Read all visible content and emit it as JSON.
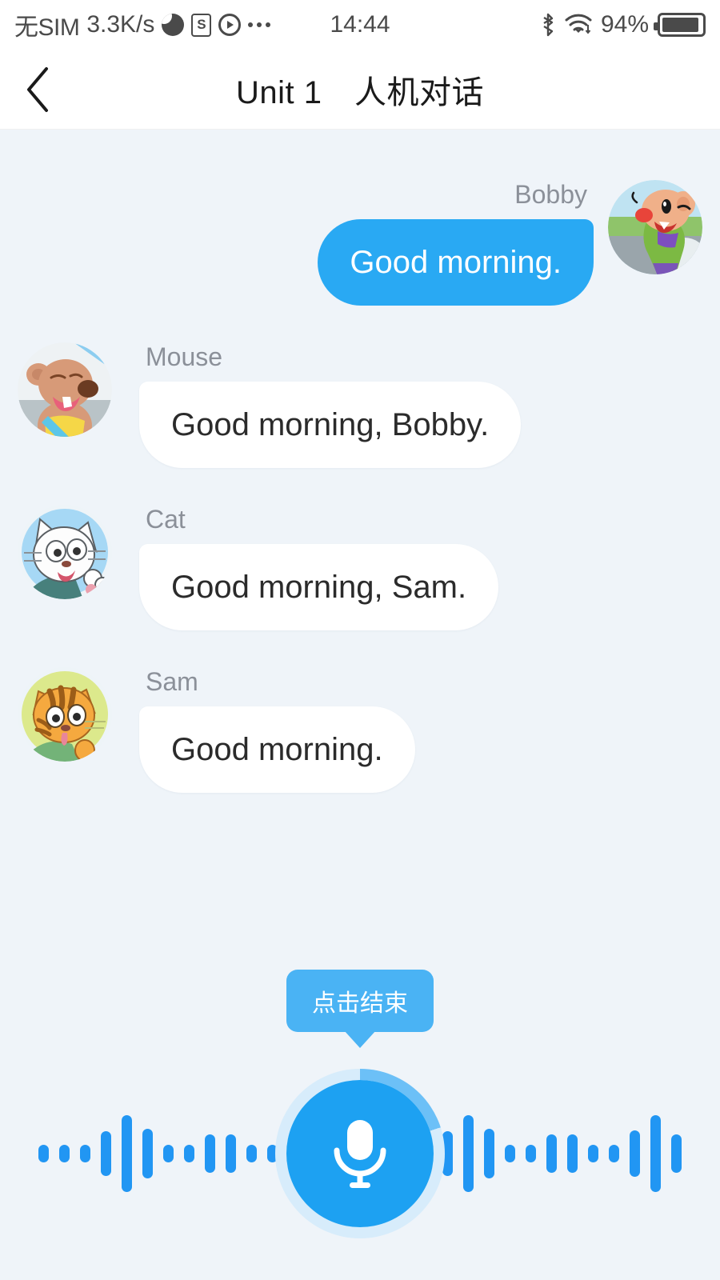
{
  "statusbar": {
    "carrier": "无SIM",
    "network_speed": "3.3K/s",
    "icons": [
      "weather-icon",
      "sogou-icon",
      "play-icon",
      "more-dots-icon"
    ],
    "time": "14:44",
    "bluetooth_icon": "bluetooth-icon",
    "wifi_icon": "wifi-icon",
    "battery_percent": "94%",
    "battery_level": 94
  },
  "header": {
    "back_icon": "back-chevron-icon",
    "title": "Unit 1　人机对话"
  },
  "chat": {
    "messages": [
      {
        "speaker": "Bobby",
        "text": "Good morning.",
        "side": "right",
        "avatar": "bobby-avatar"
      },
      {
        "speaker": "Mouse",
        "text": "Good morning, Bobby.",
        "side": "left",
        "avatar": "mouse-avatar"
      },
      {
        "speaker": "Cat",
        "text": "Good morning, Sam.",
        "side": "left",
        "avatar": "cat-avatar"
      },
      {
        "speaker": "Sam",
        "text": "Good morning.",
        "side": "left",
        "avatar": "sam-avatar"
      }
    ]
  },
  "record": {
    "tooltip_label": "点击结束",
    "mic_icon": "microphone-icon",
    "progress_degrees": 72,
    "wave_heights": [
      22,
      22,
      22,
      56,
      96,
      62,
      22,
      22,
      48,
      48,
      22,
      22,
      58,
      96,
      48
    ]
  },
  "colors": {
    "accent": "#29a9f3",
    "tooltip": "#4ab3f4",
    "background": "#eff4f9",
    "bubble_in": "#ffffff",
    "bubble_out": "#29a9f3",
    "speaker_text": "#8b9099",
    "wave": "#2196f3",
    "ring": "#d7ecfb"
  }
}
